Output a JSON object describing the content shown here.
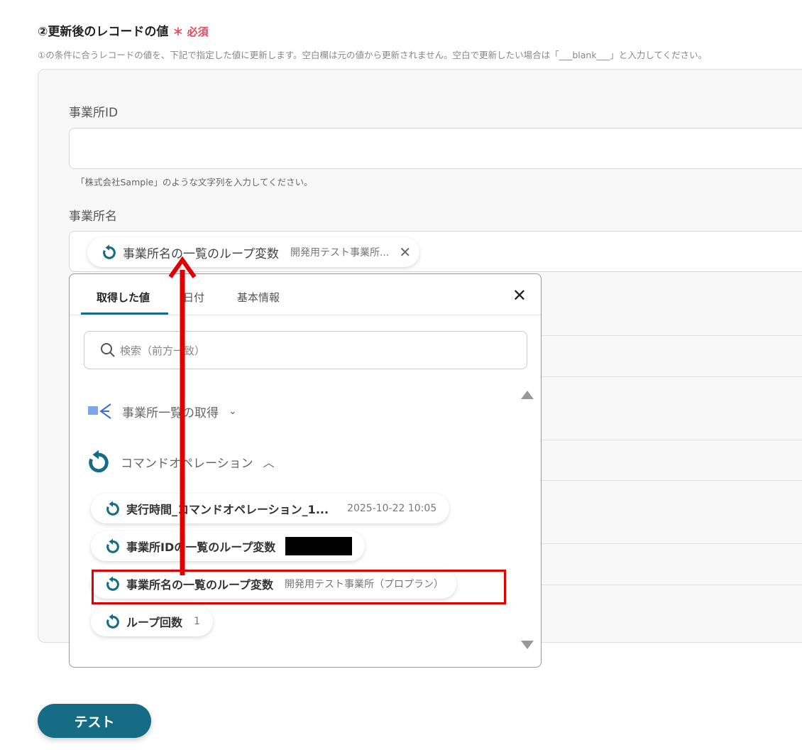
{
  "section": {
    "title": "②更新後のレコードの値",
    "required_mark": "＊",
    "required_label": "必須",
    "description": "①の条件に合うレコードの値を、下記で指定した値に更新します。空白欄は元の値から更新されません。空白で更新したい場合は「___blank___」と入力してください。"
  },
  "fields": [
    {
      "label": "事業所ID",
      "value": "",
      "hint": "「株式会社Sample」のような文字列を入力してください。"
    },
    {
      "label": "事業所名",
      "chip": {
        "name": "事業所名の一覧のループ変数",
        "value": "開発用テスト事業所..."
      }
    }
  ],
  "popup": {
    "tabs": [
      "取得した値",
      "日付",
      "基本情報"
    ],
    "search_placeholder": "検索（前方一致）",
    "groups": [
      {
        "label": "事業所一覧の取得",
        "expanded": false
      },
      {
        "label": "コマンドオペレーション",
        "expanded": true
      }
    ],
    "items": [
      {
        "name": "実行時間_コマンドオペレーション_1...",
        "value": "2025-10-22 10:05"
      },
      {
        "name": "事業所IDの一覧のループ変数",
        "value": "",
        "redacted": true
      },
      {
        "name": "事業所名の一覧のループ変数",
        "value": "開発用テスト事業所（プロプラン）",
        "highlighted": true
      },
      {
        "name": "ループ回数",
        "value": "1"
      }
    ]
  },
  "test_button": "テスト",
  "colors": {
    "accent": "#176c85",
    "required": "#e8475c",
    "annotation": "#e00000"
  }
}
